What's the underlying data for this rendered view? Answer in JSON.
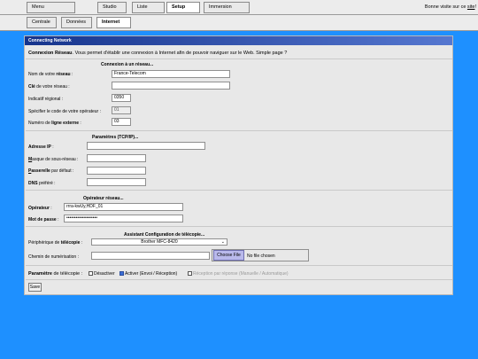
{
  "top_nav": {
    "tabs": [
      {
        "label": "Menu"
      },
      {
        "label": "Studio"
      },
      {
        "label": "Liste"
      },
      {
        "label": "Setup"
      },
      {
        "label": "Immersion"
      }
    ],
    "welcome_prefix": "Bonne visite sur ce ",
    "welcome_link": "site",
    "welcome_suffix": "!"
  },
  "sub_nav": {
    "tabs": [
      {
        "label": "Centrale"
      },
      {
        "label": "Données"
      },
      {
        "label": "Internet"
      }
    ]
  },
  "panel": {
    "title": "Connecting Network",
    "intro_bold": "Connexion Réseau",
    "intro_text": ". Vous permet d'établir une connexion à Internet afin de pouvoir naviguer sur le Web. Simple page ?"
  },
  "connexion": {
    "heading": "Connexion à un réseau...",
    "network_name": {
      "pre": "Nom de votre ",
      "bold": "réseau",
      "post": " :",
      "value": "France-Telecom"
    },
    "network_key": {
      "bold": "Clé",
      "post": " de votre réseau :",
      "value": ""
    },
    "region": {
      "label": "Indicatif régional :",
      "value": "0350"
    },
    "operator_code": {
      "label": "Spécifier le code de votre opérateur :",
      "value": "01"
    },
    "external_line": {
      "pre": "Numéro de ",
      "bold": "ligne externe",
      "post": " :",
      "value": "03"
    }
  },
  "tcpip": {
    "heading": "Paramètres (TCP/IP)...",
    "ip": {
      "bold": "Adresse IP",
      "post": " :",
      "value": ""
    },
    "mask": {
      "ul": "M",
      "post": "asque de sous-réseau :",
      "value": ""
    },
    "gateway": {
      "ul": "P",
      "bold_rest": "asserelle",
      "post": " par défaut :",
      "value": ""
    },
    "dns": {
      "bold": "DNS",
      "post": " préféré :",
      "value": ""
    }
  },
  "operateur": {
    "heading": "Opérateur réseau...",
    "operator": {
      "bold": "Opérateur",
      "post": " :",
      "value": "rrra-kwUy,HDF_01"
    },
    "password": {
      "pre": "Mot de ",
      "bold": "passe",
      "post": " :",
      "value": "••••••••••••••••••••"
    }
  },
  "fax": {
    "heading": "Assistant Configuration de télécopie...",
    "device": {
      "pre": "Périphérique de ",
      "bold": "télécopie",
      "post": " :",
      "selected": "Brother MFC-8420"
    },
    "path": {
      "label": "Chemin de numérisation :",
      "value": "",
      "button": "Choose File",
      "file_status": "No file chosen"
    }
  },
  "fax_param": {
    "bold": "Paramètre",
    "post": " de télécopie :",
    "options": [
      {
        "label": "Désactiver",
        "checked": false,
        "disabled": false
      },
      {
        "label": "Activer (Envoi / Réception)",
        "checked": true,
        "disabled": false
      },
      {
        "label": "Réception par réponse (Manuelle / Automatique)",
        "checked": false,
        "disabled": true
      }
    ]
  },
  "save_label": "Save"
}
